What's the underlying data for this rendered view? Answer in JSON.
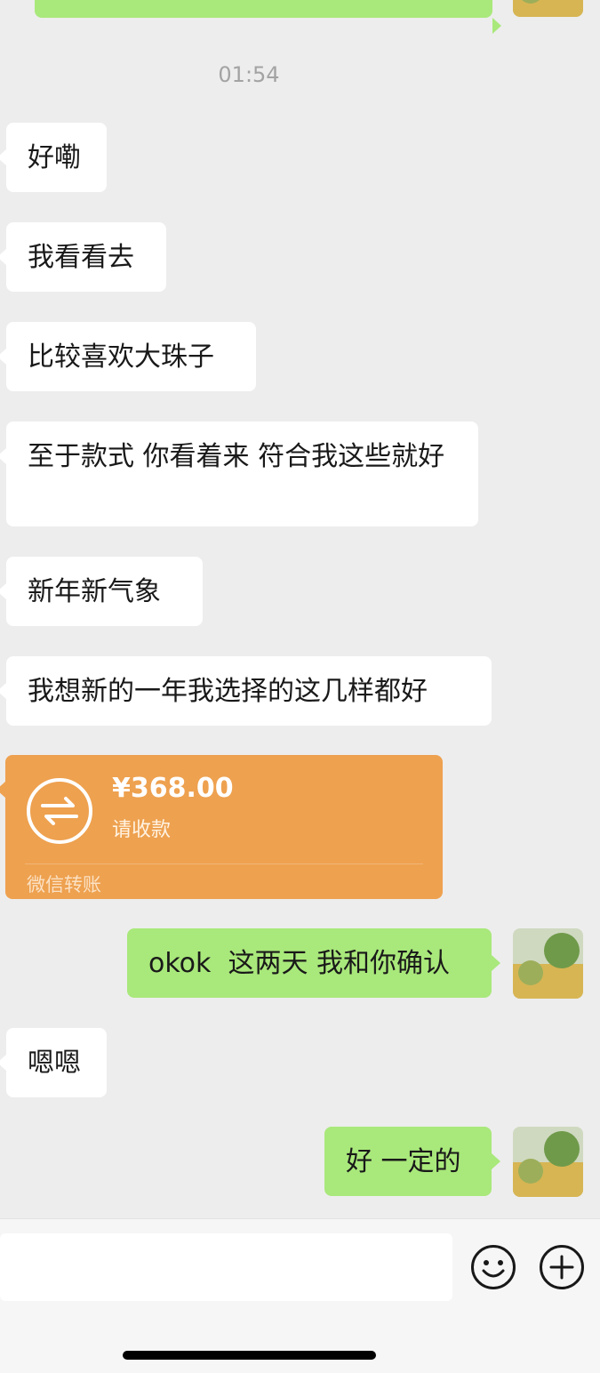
{
  "time_divider": "01:54",
  "messages": [
    {
      "side": "right",
      "text": ""
    },
    {
      "side": "left",
      "text": "好嘞"
    },
    {
      "side": "left",
      "text": "我看看去"
    },
    {
      "side": "left",
      "text": "比较喜欢大珠子"
    },
    {
      "side": "left",
      "text": "至于款式 你看着来 符合我这些就好"
    },
    {
      "side": "left",
      "text": "新年新气象"
    },
    {
      "side": "left",
      "text": "我想新的一年我选择的这几样都好"
    },
    {
      "side": "right",
      "text": "okok  这两天 我和你确认"
    },
    {
      "side": "left",
      "text": "嗯嗯"
    },
    {
      "side": "right",
      "text": "好 一定的"
    }
  ],
  "transfer": {
    "amount": "¥368.00",
    "status": "请收款",
    "footer": "微信转账",
    "icon": "transfer-arrows-icon",
    "color": "#eea14f"
  },
  "input_bar": {
    "emoji_icon": "emoji-icon",
    "plus_icon": "plus-icon"
  },
  "colors": {
    "background": "#ededed",
    "outgoing_bubble": "#a9e87b",
    "incoming_bubble": "#ffffff"
  }
}
